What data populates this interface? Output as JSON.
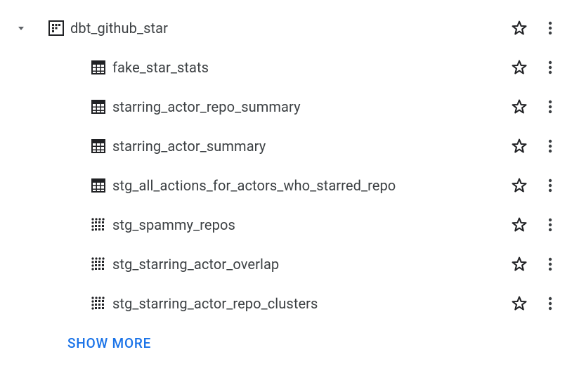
{
  "dataset": {
    "name": "dbt_github_star"
  },
  "tables": [
    {
      "name": "fake_star_stats",
      "type": "table"
    },
    {
      "name": "starring_actor_repo_summary",
      "type": "table"
    },
    {
      "name": "starring_actor_summary",
      "type": "table"
    },
    {
      "name": "stg_all_actions_for_actors_who_starred_repo",
      "type": "table"
    },
    {
      "name": "stg_spammy_repos",
      "type": "view"
    },
    {
      "name": "stg_starring_actor_overlap",
      "type": "view"
    },
    {
      "name": "stg_starring_actor_repo_clusters",
      "type": "view"
    }
  ],
  "show_more_label": "SHOW MORE"
}
